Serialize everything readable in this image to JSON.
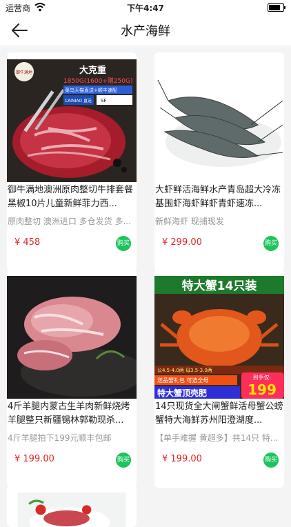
{
  "status_bar": {
    "carrier": "运营商",
    "time": "下午4:47"
  },
  "nav": {
    "title": "水产海鲜"
  },
  "products": [
    {
      "name": "御牛满地澳洲原肉整切牛排套餐黑椒10片儿童新鲜菲力西...",
      "tags": "原肉整切  澳洲进口  多仓发货  多...",
      "price": "¥ 458",
      "buy": "购买",
      "img_text": [
        "大克重",
        "1850G(1600+赠250G)",
        "菜鸟天猫直送+顺丰速配",
        "CAINIAO 直送"
      ],
      "logo_text": "御牛满地"
    },
    {
      "name": "大虾鲜活海鲜水产青岛超大冷冻基围虾海虾鲜虾青虾速冻...",
      "tags": "新鲜海虾  现捕现发",
      "price": "¥ 299.00",
      "buy": "购买"
    },
    {
      "name": "4斤羊腿内蒙古生羊肉新鲜烧烤羊腿整只新疆锡林郭勒现杀...",
      "tags": "4斤羊腿拍下199元顺丰包邮",
      "price": "¥ 199.00",
      "buy": "购买"
    },
    {
      "name": "14只现货全大闸蟹鲜活母蟹公螃蟹特大海鲜苏州阳澄湖度...",
      "tags": "【单手难握 黄超多】共14只 特...",
      "price": "¥ 199.00",
      "buy": "购买",
      "img_text": [
        "特大蟹14只装",
        "公4.5-4.0两 母3.5-3.0两",
        "送品蟹礼包 可选全母",
        "特大蟹顶壳肥",
        "到手仅:",
        "199"
      ]
    }
  ]
}
